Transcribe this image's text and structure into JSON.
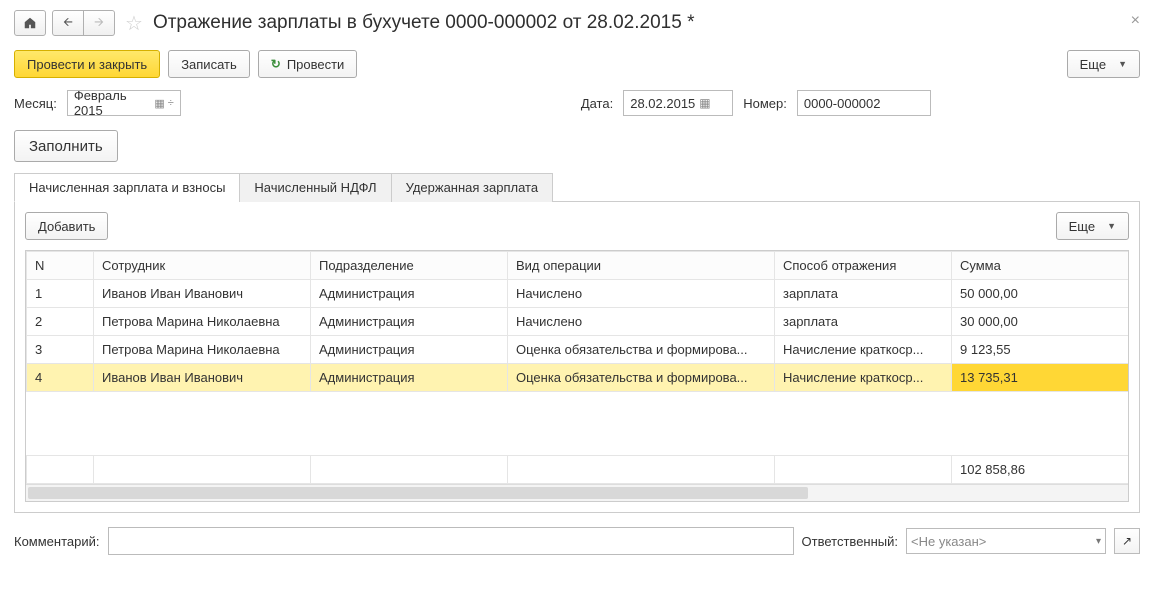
{
  "title": "Отражение зарплаты в бухучете 0000-000002 от 28.02.2015 *",
  "toolbar": {
    "post_and_close": "Провести и закрыть",
    "write": "Записать",
    "post": "Провести",
    "more": "Еще"
  },
  "fields": {
    "month_label": "Месяц:",
    "month_value": "Февраль 2015",
    "date_label": "Дата:",
    "date_value": "28.02.2015",
    "number_label": "Номер:",
    "number_value": "0000-000002",
    "fill": "Заполнить"
  },
  "tabs": {
    "t1": "Начисленная зарплата и взносы",
    "t2": "Начисленный НДФЛ",
    "t3": "Удержанная зарплата"
  },
  "panel": {
    "add": "Добавить",
    "more": "Еще"
  },
  "columns": {
    "n": "N",
    "employee": "Сотрудник",
    "department": "Подразделение",
    "operation": "Вид операции",
    "reflection": "Способ отражения",
    "sum": "Сумма"
  },
  "rows": [
    {
      "n": "1",
      "employee": "Иванов Иван Иванович",
      "department": "Администрация",
      "operation": "Начислено",
      "reflection": "зарплата",
      "sum": "50 000,00"
    },
    {
      "n": "2",
      "employee": "Петрова Марина Николаевна",
      "department": "Администрация",
      "operation": "Начислено",
      "reflection": "зарплата",
      "sum": "30 000,00"
    },
    {
      "n": "3",
      "employee": "Петрова Марина Николаевна",
      "department": "Администрация",
      "operation": "Оценка обязательства и формирова...",
      "reflection": "Начисление краткоср...",
      "sum": "9 123,55"
    },
    {
      "n": "4",
      "employee": "Иванов Иван Иванович",
      "department": "Администрация",
      "operation": "Оценка обязательства и формирова...",
      "reflection": "Начисление краткоср...",
      "sum": "13 735,31"
    }
  ],
  "total_sum": "102 858,86",
  "bottom": {
    "comment_label": "Комментарий:",
    "responsible_label": "Ответственный:",
    "responsible_placeholder": "<Не указан>"
  }
}
